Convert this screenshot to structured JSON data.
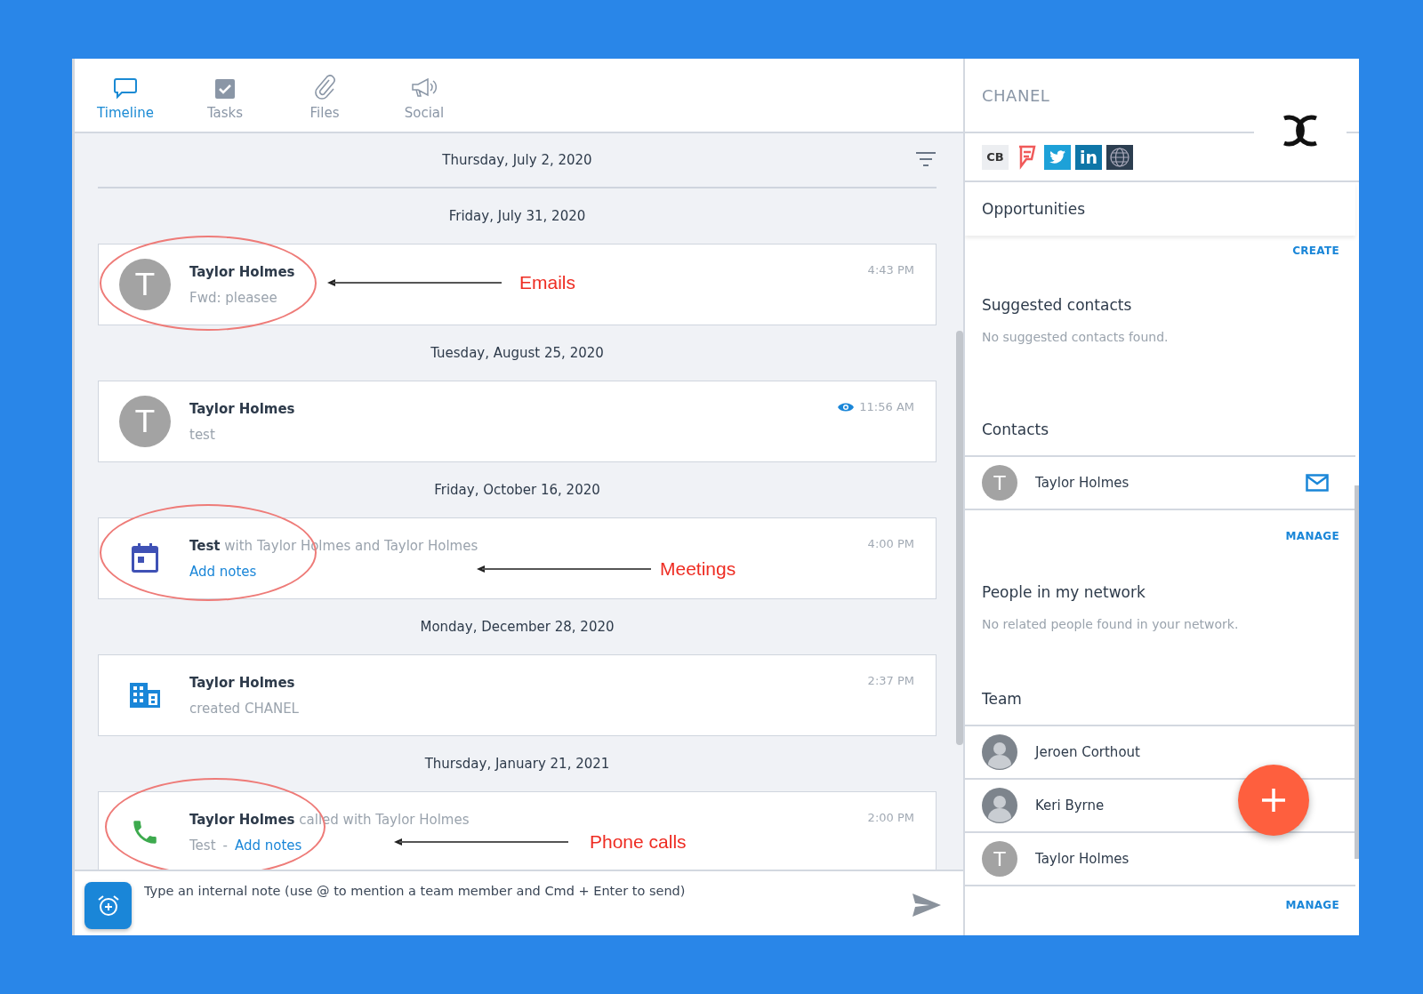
{
  "tabs": [
    {
      "label": "Timeline",
      "selected": true,
      "kind": "chat"
    },
    {
      "label": "Tasks",
      "selected": false,
      "kind": "check"
    },
    {
      "label": "Files",
      "selected": false,
      "kind": "clip"
    },
    {
      "label": "Social",
      "selected": false,
      "kind": "megaphone"
    }
  ],
  "timeline": {
    "pinned_date": "Thursday, July 2, 2020",
    "groups": [
      {
        "date": "Friday, July 31, 2020",
        "entry": {
          "kind": "avatar",
          "avatar_letter": "T",
          "title": "Taylor Holmes",
          "note": "Fwd: pleasee",
          "time": "4:43 PM",
          "seen": false,
          "annotation": "Emails"
        }
      },
      {
        "date": "Tuesday, August 25, 2020",
        "entry": {
          "kind": "avatar",
          "avatar_letter": "T",
          "title": "Taylor Holmes",
          "note": "test",
          "time": "11:56 AM",
          "seen": true
        }
      },
      {
        "date": "Friday, October 16, 2020",
        "entry": {
          "kind": "calendar",
          "title": "Test",
          "detail": "with Taylor Holmes and Taylor Holmes",
          "link": "Add notes",
          "time": "4:00 PM",
          "seen": false,
          "annotation": "Meetings"
        }
      },
      {
        "date": "Monday, December 28, 2020",
        "entry": {
          "kind": "building",
          "title": "Taylor Holmes",
          "note": "created CHANEL",
          "time": "2:37 PM",
          "seen": false
        }
      },
      {
        "date": "Thursday, January 21, 2021",
        "entry": {
          "kind": "phone",
          "title": "Taylor Holmes",
          "detail": "called with Taylor Holmes",
          "note": "Test",
          "separator": "-",
          "link": "Add notes",
          "time": "2:00 PM",
          "seen": false,
          "annotation": "Phone calls"
        }
      }
    ]
  },
  "compose": {
    "placeholder": "Type an internal note (use @ to mention a team member and Cmd + Enter to send)"
  },
  "company": {
    "name": "CHANEL",
    "profiles": [
      {
        "kind": "cb",
        "label": "CB"
      },
      {
        "kind": "foursquare"
      },
      {
        "kind": "twitter"
      },
      {
        "kind": "linkedin",
        "label": "in"
      },
      {
        "kind": "web"
      }
    ]
  },
  "opportunities": {
    "title": "Opportunities",
    "action": "CREATE"
  },
  "suggested_contacts": {
    "title": "Suggested contacts",
    "empty": "No suggested contacts found."
  },
  "contacts": {
    "title": "Contacts",
    "items": [
      {
        "name": "Taylor Holmes",
        "kind": "letter",
        "avatar_letter": "T",
        "mail": true
      }
    ],
    "action": "MANAGE"
  },
  "network": {
    "title": "People in my network",
    "empty": "No related people found in your network."
  },
  "team": {
    "title": "Team",
    "items": [
      {
        "name": "Jeroen Corthout",
        "kind": "photo"
      },
      {
        "name": "Keri Byrne",
        "kind": "photo"
      },
      {
        "name": "Taylor Holmes",
        "kind": "letter",
        "avatar_letter": "T"
      }
    ],
    "action": "MANAGE"
  }
}
